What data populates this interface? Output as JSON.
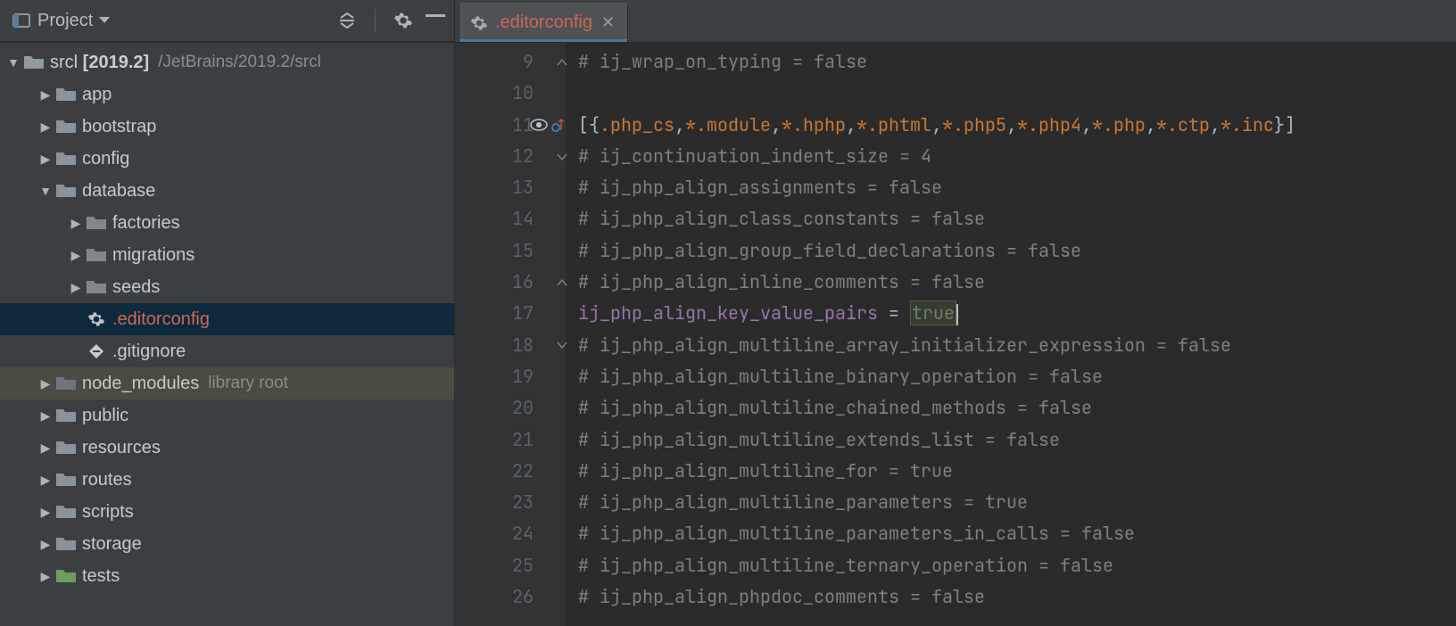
{
  "sidebar": {
    "title": "Project",
    "root": {
      "name": "srcl",
      "version": "[2019.2]",
      "path": "/JetBrains/2019.2/srcl"
    },
    "items": [
      {
        "label": "app",
        "indent": 1,
        "kind": "folder",
        "expanded": false
      },
      {
        "label": "bootstrap",
        "indent": 1,
        "kind": "folder",
        "expanded": false
      },
      {
        "label": "config",
        "indent": 1,
        "kind": "folder",
        "expanded": false
      },
      {
        "label": "database",
        "indent": 1,
        "kind": "folder",
        "expanded": true
      },
      {
        "label": "factories",
        "indent": 2,
        "kind": "folder-grey",
        "expanded": false
      },
      {
        "label": "migrations",
        "indent": 2,
        "kind": "folder-grey",
        "expanded": false
      },
      {
        "label": "seeds",
        "indent": 2,
        "kind": "folder-grey",
        "expanded": false
      },
      {
        "label": ".editorconfig",
        "indent": 2,
        "kind": "gear",
        "selected": true,
        "orange": true
      },
      {
        "label": ".gitignore",
        "indent": 2,
        "kind": "gitignore"
      },
      {
        "label": "node_modules",
        "sublabel": "library root",
        "indent": 1,
        "kind": "folder-dim",
        "expanded": false,
        "lib": true
      },
      {
        "label": "public",
        "indent": 1,
        "kind": "folder",
        "expanded": false
      },
      {
        "label": "resources",
        "indent": 1,
        "kind": "folder",
        "expanded": false
      },
      {
        "label": "routes",
        "indent": 1,
        "kind": "folder",
        "expanded": false
      },
      {
        "label": "scripts",
        "indent": 1,
        "kind": "folder",
        "expanded": false
      },
      {
        "label": "storage",
        "indent": 1,
        "kind": "folder",
        "expanded": false
      },
      {
        "label": "tests",
        "indent": 1,
        "kind": "folder-green",
        "expanded": false
      }
    ]
  },
  "editor": {
    "tab": {
      "filename": ".editorconfig"
    },
    "first_line_number": 9,
    "lines": [
      {
        "n": 9,
        "fold": "close",
        "type": "comment",
        "text": "# ij_wrap_on_typing = false"
      },
      {
        "n": 10,
        "type": "blank",
        "text": ""
      },
      {
        "n": 11,
        "badges": true,
        "type": "header",
        "segs": [
          "[{",
          ".php_cs",
          ",",
          "*.module",
          ",",
          "*.hphp",
          ",",
          "*.phtml",
          ",",
          "*.php5",
          ",",
          "*.php4",
          ",",
          "*.php",
          ",",
          "*.ctp",
          ",",
          "*.inc",
          "}]"
        ]
      },
      {
        "n": 12,
        "fold": "open",
        "type": "comment",
        "text": "# ij_continuation_indent_size = 4"
      },
      {
        "n": 13,
        "type": "comment",
        "text": "# ij_php_align_assignments = false"
      },
      {
        "n": 14,
        "type": "comment",
        "text": "# ij_php_align_class_constants = false"
      },
      {
        "n": 15,
        "type": "comment",
        "text": "# ij_php_align_group_field_declarations = false"
      },
      {
        "n": 16,
        "fold": "close",
        "type": "comment",
        "text": "# ij_php_align_inline_comments = false"
      },
      {
        "n": 17,
        "type": "setting",
        "key": "ij_php_align_key_value_pairs",
        "op": " = ",
        "val": "true",
        "caret": true
      },
      {
        "n": 18,
        "fold": "open",
        "type": "comment",
        "text": "# ij_php_align_multiline_array_initializer_expression = false"
      },
      {
        "n": 19,
        "type": "comment",
        "text": "# ij_php_align_multiline_binary_operation = false"
      },
      {
        "n": 20,
        "type": "comment",
        "text": "# ij_php_align_multiline_chained_methods = false"
      },
      {
        "n": 21,
        "type": "comment",
        "text": "# ij_php_align_multiline_extends_list = false"
      },
      {
        "n": 22,
        "type": "comment",
        "text": "# ij_php_align_multiline_for = true"
      },
      {
        "n": 23,
        "type": "comment",
        "text": "# ij_php_align_multiline_parameters = true"
      },
      {
        "n": 24,
        "type": "comment",
        "text": "# ij_php_align_multiline_parameters_in_calls = false"
      },
      {
        "n": 25,
        "type": "comment",
        "text": "# ij_php_align_multiline_ternary_operation = false"
      },
      {
        "n": 26,
        "type": "comment",
        "text": "# ij_php_align_phpdoc_comments = false"
      }
    ]
  }
}
